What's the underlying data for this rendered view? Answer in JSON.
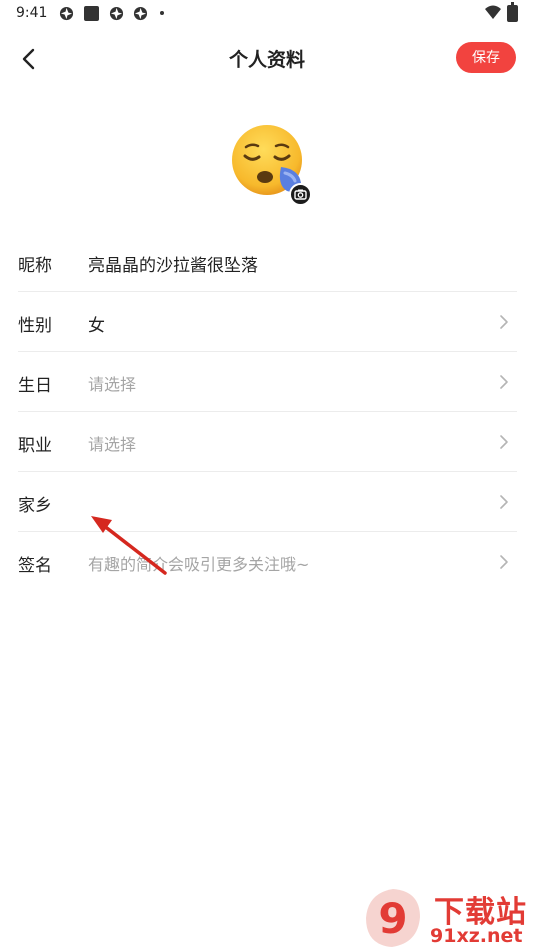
{
  "status_bar": {
    "time": "9:41",
    "icons": [
      "aperture-icon",
      "square-icon",
      "aperture-icon",
      "aperture-icon",
      "dot-icon",
      "wifi-icon",
      "battery-icon"
    ]
  },
  "header": {
    "title": "个人资料",
    "save_label": "保存",
    "back_icon": "chevron-left-icon",
    "accent_color": "#f2433f"
  },
  "avatar": {
    "emoji": "sleepy-face-emoji",
    "camera_icon": "camera-icon"
  },
  "fields": [
    {
      "label": "昵称",
      "value": "亮晶晶的沙拉酱很坠落",
      "placeholder": false,
      "has_chevron": false
    },
    {
      "label": "性别",
      "value": "女",
      "placeholder": false,
      "has_chevron": true
    },
    {
      "label": "生日",
      "value": "请选择",
      "placeholder": true,
      "has_chevron": true
    },
    {
      "label": "职业",
      "value": "请选择",
      "placeholder": true,
      "has_chevron": true
    },
    {
      "label": "家乡",
      "value": "",
      "placeholder": false,
      "has_chevron": true
    },
    {
      "label": "签名",
      "value": "有趣的简介会吸引更多关注哦~",
      "placeholder": true,
      "has_chevron": true
    }
  ],
  "watermark": {
    "line1": "下载站",
    "line2": "91xz.net",
    "logo_text": "9"
  }
}
